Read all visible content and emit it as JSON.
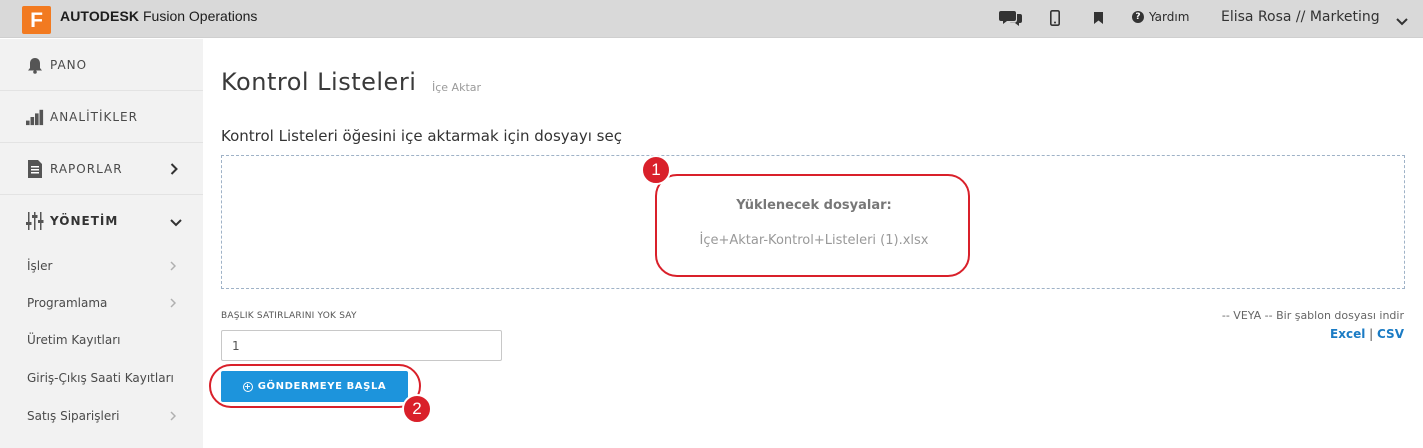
{
  "app": {
    "logo_letter": "F",
    "brand_bold": "AUTODESK",
    "brand_product": "Fusion Operations",
    "brand_color": "#f27a20"
  },
  "header": {
    "icons": [
      "chat-icon",
      "mobile-icon",
      "bookmark-icon"
    ],
    "help_label": "Yardım",
    "user_label": "Elisa Rosa // Marketing"
  },
  "sidebar": {
    "items": [
      {
        "label": "PANO",
        "icon": "bell-icon"
      },
      {
        "label": "ANALİTİKLER",
        "icon": "bar-chart-icon"
      },
      {
        "label": "RAPORLAR",
        "icon": "report-icon"
      },
      {
        "label": "YÖNETİM",
        "icon": "sliders-icon"
      }
    ],
    "subitems": [
      {
        "label": "İşler",
        "has_arrow": true
      },
      {
        "label": "Programlama",
        "has_arrow": true
      },
      {
        "label": "Üretim Kayıtları",
        "has_arrow": false
      },
      {
        "label": "Giriş-Çıkış Saati Kayıtları",
        "has_arrow": false
      },
      {
        "label": "Satış Siparişleri",
        "has_arrow": true
      }
    ]
  },
  "main": {
    "title": "Kontrol Listeleri",
    "subtitle": "İçe Aktar",
    "instruction": "Kontrol Listeleri öğesini içe aktarmak için dosyayı seç",
    "dropzone": {
      "files_title": "Yüklenecek dosyalar:",
      "file_name": "İçe+Aktar-Kontrol+Listeleri (1).xlsx"
    },
    "skip_header": {
      "label": "BAŞLIK SATIRLARINI YOK SAY",
      "value": "1"
    },
    "submit_label": "GÖNDERMEYE BAŞLA",
    "template": {
      "text": "-- VEYA -- Bir şablon dosyası indir",
      "excel": "Excel",
      "separator": "|",
      "csv": "CSV"
    }
  },
  "annotations": {
    "badge_1": "1",
    "badge_2": "2",
    "color": "#d9202a"
  }
}
